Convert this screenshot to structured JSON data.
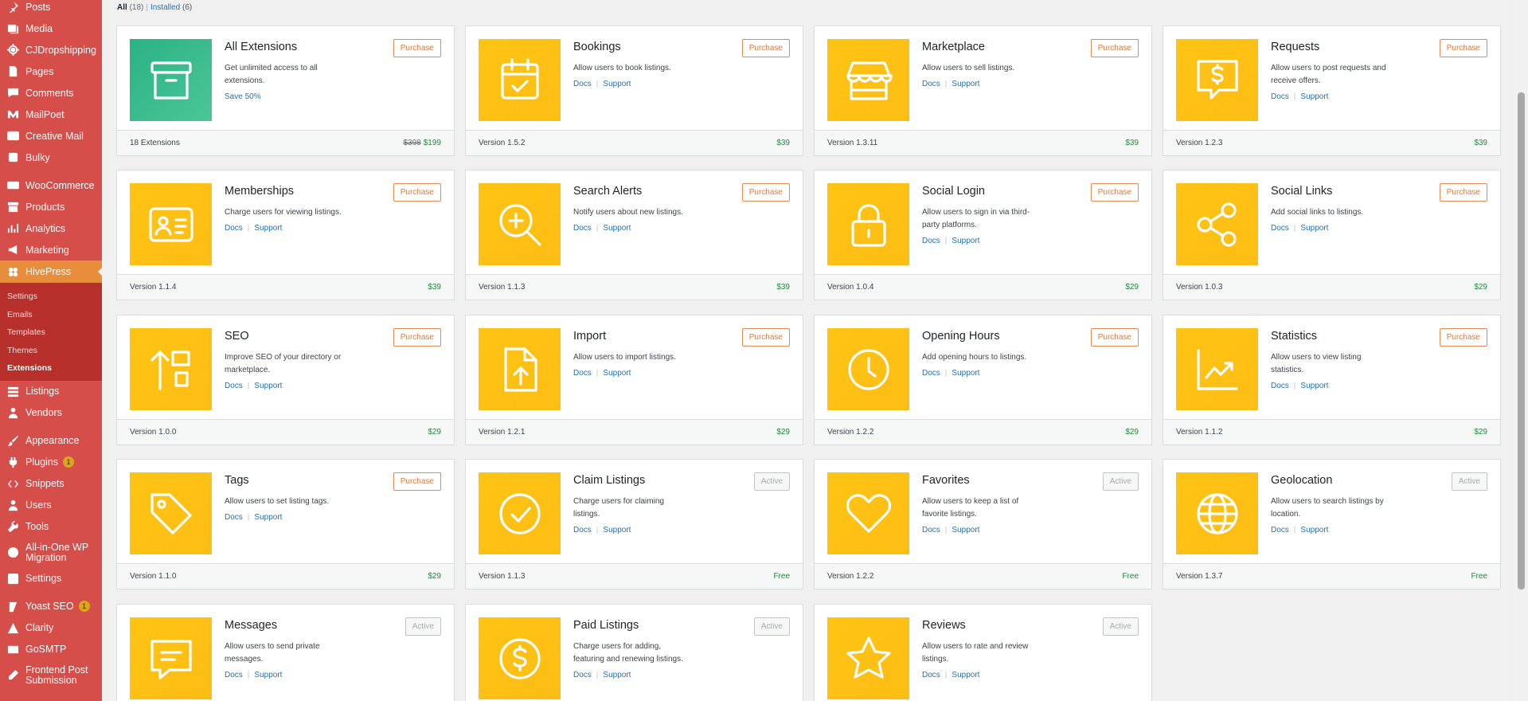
{
  "sidebar": {
    "items": [
      {
        "label": "Posts",
        "icon": "pin-icon"
      },
      {
        "label": "Media",
        "icon": "media-icon"
      },
      {
        "label": "CJDropshipping",
        "icon": "gear-icon"
      },
      {
        "label": "Pages",
        "icon": "page-icon"
      },
      {
        "label": "Comments",
        "icon": "comment-icon"
      },
      {
        "label": "MailPoet",
        "icon": "mailpoet-icon"
      },
      {
        "label": "Creative Mail",
        "icon": "cm-icon"
      },
      {
        "label": "Bulky",
        "icon": "box-icon"
      },
      {
        "label": "WooCommerce",
        "icon": "woo-icon"
      },
      {
        "label": "Products",
        "icon": "archive-icon"
      },
      {
        "label": "Analytics",
        "icon": "chart-icon"
      },
      {
        "label": "Marketing",
        "icon": "megaphone-icon"
      },
      {
        "label": "HivePress",
        "icon": "hive-icon"
      },
      {
        "label": "Listings",
        "icon": "list-icon"
      },
      {
        "label": "Vendors",
        "icon": "users-icon"
      },
      {
        "label": "Appearance",
        "icon": "brush-icon"
      },
      {
        "label": "Plugins",
        "icon": "plugin-icon",
        "badge": "1"
      },
      {
        "label": "Snippets",
        "icon": "snippet-icon"
      },
      {
        "label": "Users",
        "icon": "user-icon"
      },
      {
        "label": "Tools",
        "icon": "wrench-icon"
      },
      {
        "label": "All-in-One WP Migration",
        "icon": "migration-icon"
      },
      {
        "label": "Settings",
        "icon": "settings-icon"
      },
      {
        "label": "Yoast SEO",
        "icon": "yoast-icon",
        "badge": "1"
      },
      {
        "label": "Clarity",
        "icon": "clarity-icon"
      },
      {
        "label": "GoSMTP",
        "icon": "mail-icon"
      },
      {
        "label": "Frontend Post Submission",
        "icon": "edit-icon"
      }
    ],
    "hivepress_submenu": [
      "Settings",
      "Emails",
      "Templates",
      "Themes",
      "Extensions"
    ]
  },
  "filters": {
    "all": "All",
    "all_count": "(18)",
    "installed": "Installed",
    "installed_count": "(6)"
  },
  "cards": [
    {
      "title": "All Extensions",
      "desc": "Get unlimited access to all extensions.",
      "link1": "Save 50%",
      "button": "Purchase",
      "version": "18 Extensions",
      "old_price": "$398",
      "price": "$199",
      "icon": "archive-box-icon",
      "green": true
    },
    {
      "title": "Bookings",
      "desc": "Allow users to book listings.",
      "link1": "Docs",
      "link2": "Support",
      "button": "Purchase",
      "version": "Version 1.5.2",
      "price": "$39",
      "icon": "calendar-check-icon"
    },
    {
      "title": "Marketplace",
      "desc": "Allow users to sell listings.",
      "link1": "Docs",
      "link2": "Support",
      "button": "Purchase",
      "version": "Version 1.3.11",
      "price": "$39",
      "icon": "storefront-icon"
    },
    {
      "title": "Requests",
      "desc": "Allow users to post requests and receive offers.",
      "link1": "Docs",
      "link2": "Support",
      "button": "Purchase",
      "version": "Version 1.2.3",
      "price": "$39",
      "icon": "dollar-message-icon"
    },
    {
      "title": "Memberships",
      "desc": "Charge users for viewing listings.",
      "link1": "Docs",
      "link2": "Support",
      "button": "Purchase",
      "version": "Version 1.1.4",
      "price": "$39",
      "icon": "id-card-icon"
    },
    {
      "title": "Search Alerts",
      "desc": "Notify users about new listings.",
      "link1": "Docs",
      "link2": "Support",
      "button": "Purchase",
      "version": "Version 1.1.3",
      "price": "$39",
      "icon": "zoom-in-icon"
    },
    {
      "title": "Social Login",
      "desc": "Allow users to sign in via third-party platforms.",
      "link1": "Docs",
      "link2": "Support",
      "button": "Purchase",
      "version": "Version 1.0.4",
      "price": "$29",
      "icon": "lock-icon"
    },
    {
      "title": "Social Links",
      "desc": "Add social links to listings.",
      "link1": "Docs",
      "link2": "Support",
      "button": "Purchase",
      "version": "Version 1.0.3",
      "price": "$29",
      "icon": "share-icon"
    },
    {
      "title": "SEO",
      "desc": "Improve SEO of your directory or marketplace.",
      "link1": "Docs",
      "link2": "Support",
      "button": "Purchase",
      "version": "Version 1.0.0",
      "price": "$29",
      "icon": "sort-up-icon"
    },
    {
      "title": "Import",
      "desc": "Allow users to import listings.",
      "link1": "Docs",
      "link2": "Support",
      "button": "Purchase",
      "version": "Version 1.2.1",
      "price": "$29",
      "icon": "file-upload-icon"
    },
    {
      "title": "Opening Hours",
      "desc": "Add opening hours to listings.",
      "link1": "Docs",
      "link2": "Support",
      "button": "Purchase",
      "version": "Version 1.2.2",
      "price": "$29",
      "icon": "clock-icon"
    },
    {
      "title": "Statistics",
      "desc": "Allow users to view listing statistics.",
      "link1": "Docs",
      "link2": "Support",
      "button": "Purchase",
      "version": "Version 1.1.2",
      "price": "$29",
      "icon": "trending-chart-icon"
    },
    {
      "title": "Tags",
      "desc": "Allow users to set listing tags.",
      "link1": "Docs",
      "link2": "Support",
      "button": "Purchase",
      "version": "Version 1.1.0",
      "price": "$29",
      "icon": "tag-icon"
    },
    {
      "title": "Claim Listings",
      "desc": "Charge users for claiming listings.",
      "link1": "Docs",
      "link2": "Support",
      "button": "Active",
      "version": "Version 1.1.3",
      "price": "Free",
      "icon": "check-circle-icon"
    },
    {
      "title": "Favorites",
      "desc": "Allow users to keep a list of favorite listings.",
      "link1": "Docs",
      "link2": "Support",
      "button": "Active",
      "version": "Version 1.2.2",
      "price": "Free",
      "icon": "heart-icon"
    },
    {
      "title": "Geolocation",
      "desc": "Allow users to search listings by location.",
      "link1": "Docs",
      "link2": "Support",
      "button": "Active",
      "version": "Version 1.3.7",
      "price": "Free",
      "icon": "globe-icon"
    },
    {
      "title": "Messages",
      "desc": "Allow users to send private messages.",
      "link1": "Docs",
      "link2": "Support",
      "button": "Active",
      "version": "",
      "price": "",
      "icon": "message-icon"
    },
    {
      "title": "Paid Listings",
      "desc": "Charge users for adding, featuring and renewing listings.",
      "link1": "Docs",
      "link2": "Support",
      "button": "Active",
      "version": "",
      "price": "",
      "icon": "dollar-circle-icon"
    },
    {
      "title": "Reviews",
      "desc": "Allow users to rate and review listings.",
      "link1": "Docs",
      "link2": "Support",
      "button": "Active",
      "version": "",
      "price": "",
      "icon": "star-icon"
    }
  ]
}
